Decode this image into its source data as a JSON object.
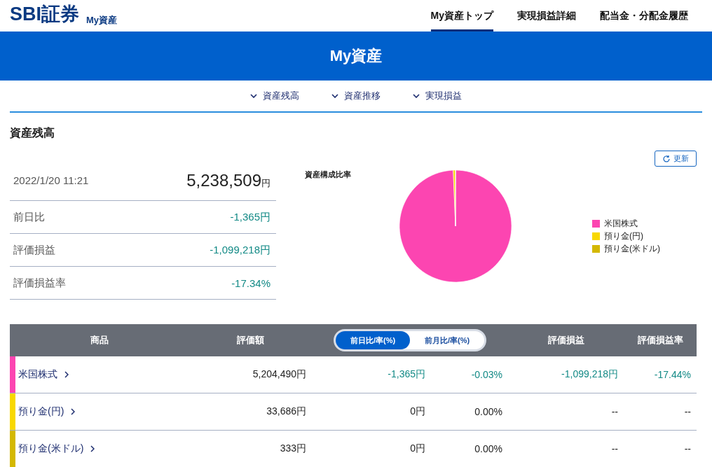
{
  "header": {
    "logo": "SBI証券",
    "subtitle": "My資産",
    "nav": [
      {
        "label": "My資産トップ",
        "selected": true
      },
      {
        "label": "実現損益詳細",
        "selected": false
      },
      {
        "label": "配当金・分配金履歴",
        "selected": false
      }
    ]
  },
  "banner": {
    "title": "My資産"
  },
  "anchors": [
    "資産残高",
    "資産推移",
    "実現損益"
  ],
  "section": {
    "title": "資産残高",
    "refresh": "更新"
  },
  "summary": {
    "datetime": "2022/1/20 11:21",
    "total": "5,238,509",
    "total_unit": "円",
    "rows": [
      {
        "label": "前日比",
        "value": "-1,365円",
        "negative": true
      },
      {
        "label": "評価損益",
        "value": "-1,099,218円",
        "negative": true
      },
      {
        "label": "評価損益率",
        "value": "-17.34%",
        "negative": true
      }
    ]
  },
  "chart": {
    "chart_data": {
      "type": "pie",
      "title": "資産構成比率",
      "categories": [
        "米国株式",
        "預り金(円)",
        "預り金(米ドル)"
      ],
      "values": [
        99.35,
        0.64,
        0.01
      ],
      "colors": [
        "#fc45b1",
        "#f8d800",
        "#d4b800"
      ],
      "legend": true
    }
  },
  "table": {
    "columns": [
      {
        "label": "商品"
      },
      {
        "label": "評価額"
      },
      {
        "label": "評価損益"
      },
      {
        "label": "評価損益率"
      }
    ],
    "toggle": [
      {
        "label": "前日比/率(%)",
        "selected": true
      },
      {
        "label": "前月比/率(%)",
        "selected": false
      }
    ],
    "rows": [
      {
        "name": "米国株式",
        "color": "#fc45b1",
        "value": "5,204,490円",
        "change": "-1,365円",
        "change_rate": "-0.03%",
        "pl": "-1,099,218円",
        "pl_rate": "-17.44%",
        "negative": true
      },
      {
        "name": "預り金(円)",
        "color": "#f8d800",
        "value": "33,686円",
        "change": "0円",
        "change_rate": "0.00%",
        "pl": "--",
        "pl_rate": "--",
        "negative": false
      },
      {
        "name": "預り金(米ドル)",
        "color": "#d4b800",
        "value": "333円",
        "change": "0円",
        "change_rate": "0.00%",
        "pl": "--",
        "pl_rate": "--",
        "negative": false
      }
    ]
  }
}
